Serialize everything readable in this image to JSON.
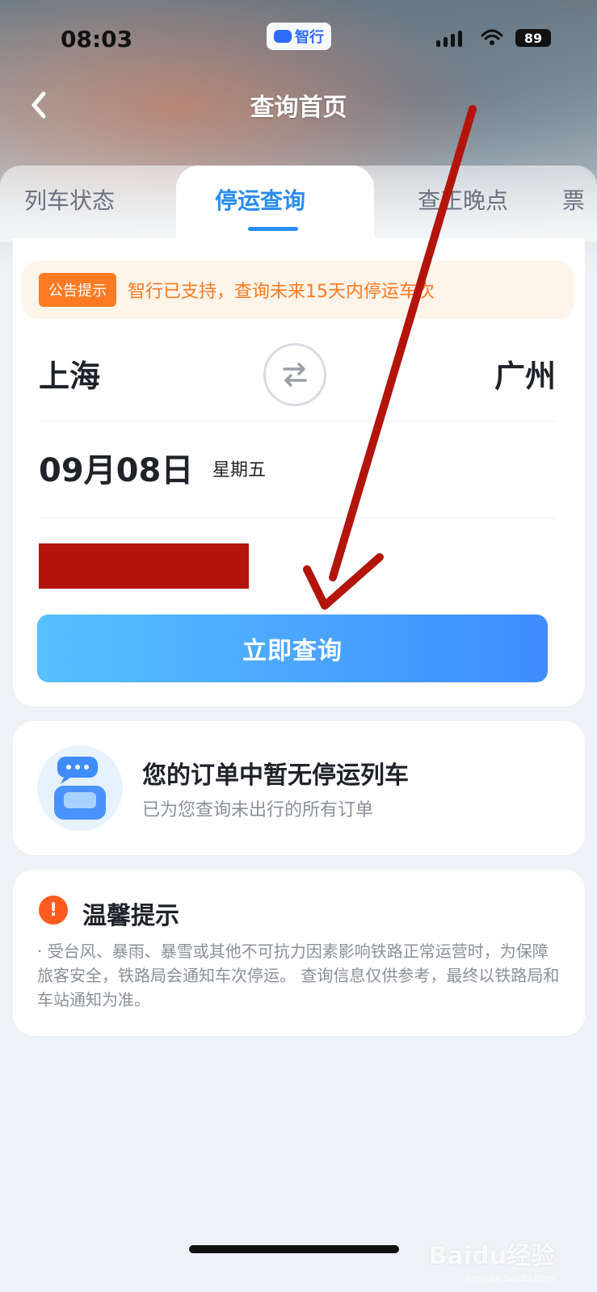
{
  "status_bar": {
    "time": "08:03",
    "app_badge": "智行",
    "battery": "89"
  },
  "nav": {
    "title": "查询首页"
  },
  "tabs": [
    {
      "label": "列车状态"
    },
    {
      "label": "停运查询"
    },
    {
      "label": "查正晚点"
    },
    {
      "label": "票"
    }
  ],
  "notice": {
    "tag": "公告提示",
    "text": "智行已支持，查询未来15天内停运车次"
  },
  "route": {
    "from": "上海",
    "to": "广州"
  },
  "date": {
    "value": "09月08日",
    "weekday": "星期五"
  },
  "actions": {
    "query_label": "立即查询"
  },
  "orders": {
    "title": "您的订单中暂无停运列车",
    "subtitle": "已为您查询未出行的所有订单"
  },
  "tips": {
    "title": "温馨提示",
    "text": "· 受台风、暴雨、暴雪或其他不可抗力因素影响铁路正常运营时，为保障旅客安全，铁路局会通知车次停运。 查询信息仅供参考，最终以铁路局和车站通知为准。"
  },
  "watermark": {
    "main": "Baidu经验",
    "sub": "jingyan.baidu.com"
  },
  "colors": {
    "accent": "#2a8cf0",
    "notice": "#ff7a22",
    "annotation": "#b3140c"
  }
}
